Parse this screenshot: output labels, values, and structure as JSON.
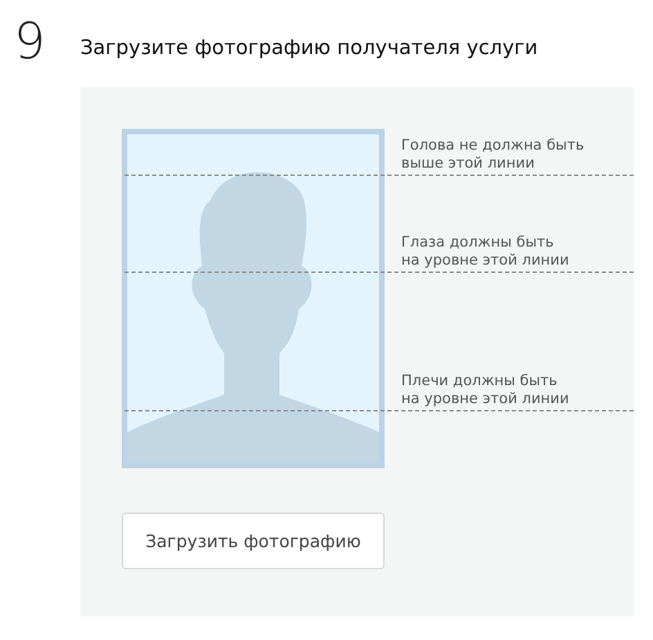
{
  "step": {
    "number": "9",
    "title": "Загрузите фотографию получателя услуги"
  },
  "guides": [
    {
      "kind": "head",
      "lines": [
        "Голова не должна быть",
        "выше этой линии"
      ]
    },
    {
      "kind": "eyes",
      "lines": [
        "Глаза должны быть",
        "на уровне этой линии"
      ]
    },
    {
      "kind": "shoulders",
      "lines": [
        "Плечи должны быть",
        "на уровне этой линии"
      ]
    }
  ],
  "upload_button": {
    "label": "Загрузить фотографию"
  }
}
